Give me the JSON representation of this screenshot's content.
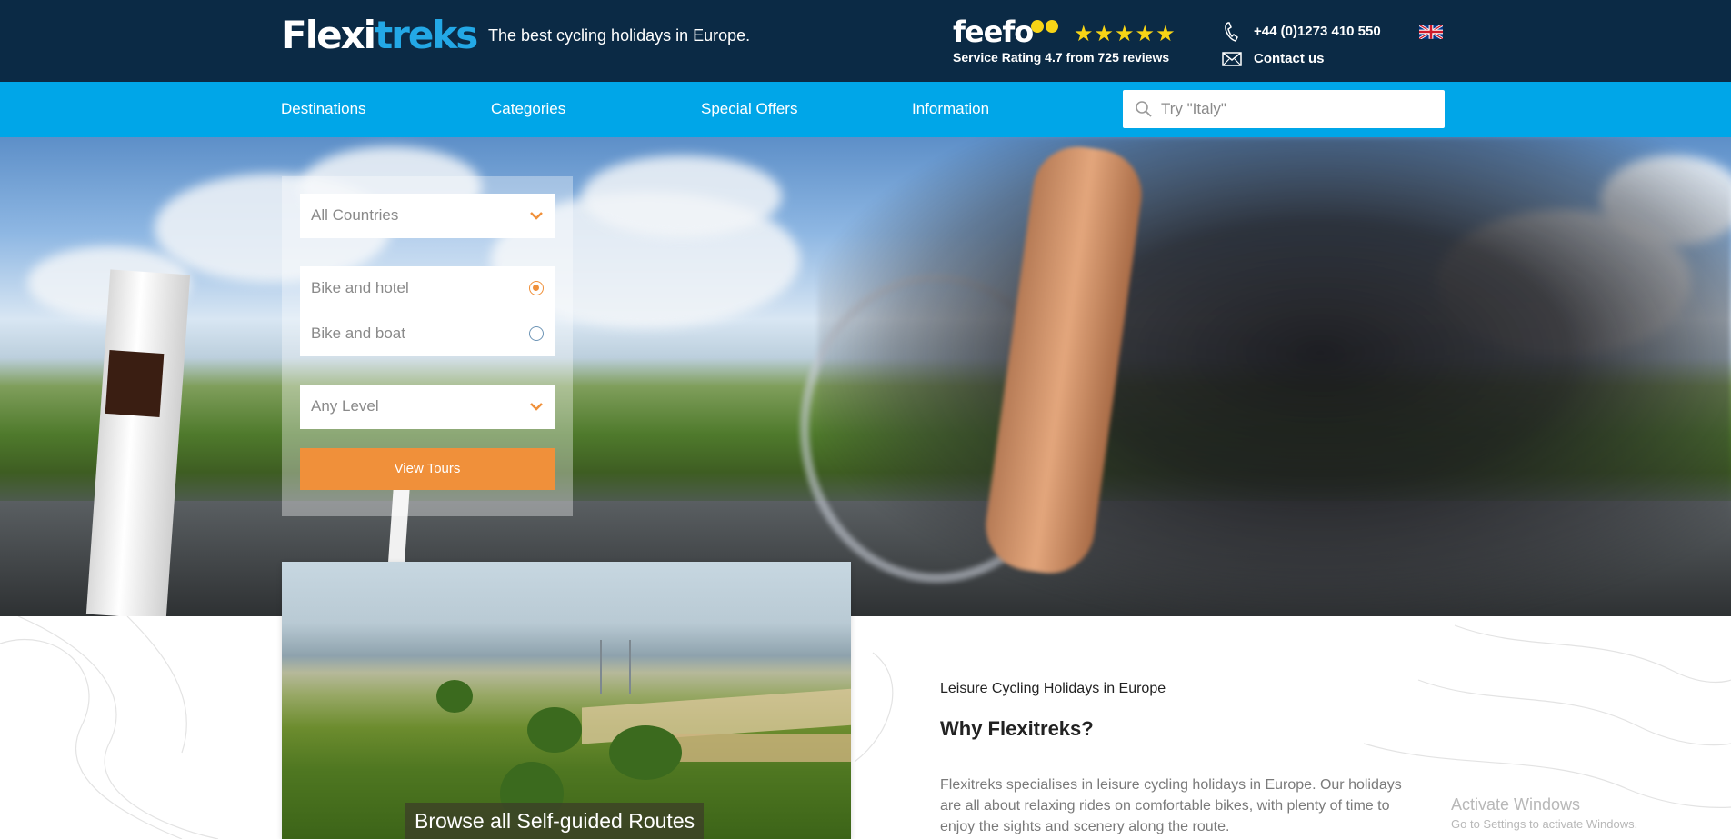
{
  "header": {
    "logo_white": "Flexi",
    "logo_blue": "treks",
    "tagline": "The best cycling holidays in Europe.",
    "feefo_name": "feefo",
    "stars": "★★★★★",
    "rating_text": "Service Rating 4.7 from 725 reviews",
    "phone": "+44 (0)1273 410 550",
    "contact": "Contact us",
    "flag_icon": "uk-flag-icon"
  },
  "nav": {
    "items": [
      "Destinations",
      "Categories",
      "Special Offers",
      "Information"
    ],
    "search_placeholder": "Try \"Italy\""
  },
  "search_panel": {
    "country_select": "All Countries",
    "options": [
      {
        "label": "Bike and hotel",
        "selected": true
      },
      {
        "label": "Bike and boat",
        "selected": false
      }
    ],
    "level_select": "Any Level",
    "button": "View Tours"
  },
  "feature_card": {
    "caption": "Browse all Self-guided Routes"
  },
  "intro": {
    "eyebrow": "Leisure Cycling Holidays in Europe",
    "heading": "Why Flexitreks?",
    "paragraph": "Flexitreks specialises in leisure cycling holidays in Europe. Our holidays are all about relaxing rides on comfortable bikes, with plenty of time to enjoy the sights and scenery along the route."
  },
  "watermark": {
    "title": "Activate Windows",
    "subtitle": "Go to Settings to activate Windows."
  },
  "colors": {
    "header_bg": "#0b2a45",
    "nav_bg": "#00a6e8",
    "accent_orange": "#f0903a",
    "brand_blue": "#23a8e6",
    "star_yellow": "#f7d416"
  }
}
